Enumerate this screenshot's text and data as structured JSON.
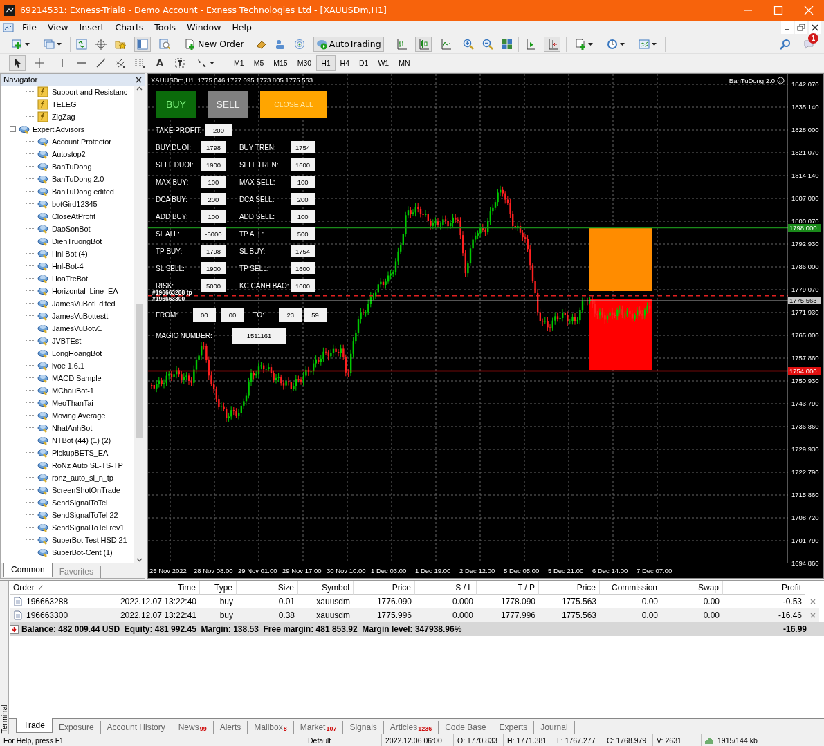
{
  "window": {
    "title": "69214531: Exness-Trial8 - Demo Account - Exness Technologies Ltd - [XAUUSDm,H1]"
  },
  "menu": [
    "File",
    "View",
    "Insert",
    "Charts",
    "Tools",
    "Window",
    "Help"
  ],
  "toolbar": {
    "new_order": "New Order",
    "auto_trading": "AutoTrading",
    "notification_count": "1"
  },
  "drawing_tools": {
    "text_tool": "A"
  },
  "timeframes": [
    {
      "label": "M1",
      "selected": false
    },
    {
      "label": "M5",
      "selected": false
    },
    {
      "label": "M15",
      "selected": false
    },
    {
      "label": "M30",
      "selected": false
    },
    {
      "label": "H1",
      "selected": true
    },
    {
      "label": "H4",
      "selected": false
    },
    {
      "label": "D1",
      "selected": false
    },
    {
      "label": "W1",
      "selected": false
    },
    {
      "label": "MN",
      "selected": false
    }
  ],
  "navigator": {
    "title": "Navigator",
    "indicators": [
      {
        "label": "Support and Resistanc"
      },
      {
        "label": "TELEG"
      },
      {
        "label": "ZigZag"
      }
    ],
    "expert_advisors": {
      "label": "Expert Advisors",
      "expanded": true,
      "children": [
        {
          "label": "Account Protector"
        },
        {
          "label": "Autostop2"
        },
        {
          "label": "BanTuDong"
        },
        {
          "label": "BanTuDong 2.0"
        },
        {
          "label": "BanTuDong edited"
        },
        {
          "label": "botGird12345"
        },
        {
          "label": "CloseAtProfit"
        },
        {
          "label": "DaoSonBot"
        },
        {
          "label": "DienTruongBot"
        },
        {
          "label": "Hnl Bot (4)"
        },
        {
          "label": "Hnl-Bot-4"
        },
        {
          "label": "HoaTreBot"
        },
        {
          "label": "Horizontal_Line_EA"
        },
        {
          "label": "JamesVuBotEdited"
        },
        {
          "label": "JamesVuBottestt"
        },
        {
          "label": "JamesVuBotv1"
        },
        {
          "label": "JVBTEst"
        },
        {
          "label": "LongHoangBot"
        },
        {
          "label": "lvoe 1.6.1"
        },
        {
          "label": "MACD Sample"
        },
        {
          "label": "MChauBot-1"
        },
        {
          "label": "MeoThanTai"
        },
        {
          "label": "Moving Average"
        },
        {
          "label": "NhatAnhBot"
        },
        {
          "label": "NTBot (44) (1) (2)"
        },
        {
          "label": "PickupBETS_EA"
        },
        {
          "label": "RoNz Auto SL-TS-TP"
        },
        {
          "label": "ronz_auto_sl_n_tp"
        },
        {
          "label": "ScreenShotOnTrade"
        },
        {
          "label": "SendSignalToTel"
        },
        {
          "label": "SendSignalToTel 22"
        },
        {
          "label": "SendSignalToTel rev1"
        },
        {
          "label": "SuperBot Test HSD 21-"
        },
        {
          "label": "SuperBot-Cent (1)"
        }
      ]
    },
    "tabs": [
      {
        "label": "Common",
        "selected": true
      },
      {
        "label": "Favorites",
        "selected": false
      }
    ]
  },
  "chart": {
    "header": "XAUUSDm,H1  1775.046 1777.095 1773.805 1775.563",
    "expert_name": "BanTuDong 2.0",
    "price_labels": [
      "1842.070",
      "1835.140",
      "1828.000",
      "1821.070",
      "1814.140",
      "1807.000",
      "1800.070",
      "1792.930",
      "1786.000",
      "1779.070",
      "1771.930",
      "1765.000",
      "1757.860",
      "1750.930",
      "1743.790",
      "1736.860",
      "1729.930",
      "1722.790",
      "1715.860",
      "1708.720",
      "1701.790",
      "1694.860"
    ],
    "price_tags": [
      {
        "text": "1798.000",
        "color": "#1a8a1a"
      },
      {
        "text": "1775.563",
        "color": "#c8c8c8"
      },
      {
        "text": "1754.000",
        "color": "#e01010"
      }
    ],
    "time_labels": [
      "25 Nov 2022",
      "28 Nov 08:00",
      "29 Nov 01:00",
      "29 Nov 17:00",
      "30 Nov 10:00",
      "1 Dec 03:00",
      "1 Dec 19:00",
      "2 Dec 12:00",
      "5 Dec 05:00",
      "5 Dec 21:00",
      "6 Dec 14:00",
      "7 Dec 07:00"
    ],
    "order_labels": [
      "#196663288 tp",
      "#196663300"
    ],
    "panel": {
      "buttons": [
        {
          "label": "BUY",
          "color": "#0b6b0b"
        },
        {
          "label": "SELL",
          "color": "#808080"
        },
        {
          "label": "CLOSE ALL",
          "color": "#ffa500"
        }
      ],
      "rows": [
        [
          {
            "label": "TAKE PROFIT:",
            "value": "200"
          }
        ],
        [
          {
            "label": "BUY DUOI:",
            "value": "1798"
          },
          {
            "label": "BUY TREN:",
            "value": "1754"
          }
        ],
        [
          {
            "label": "SELL DUOI:",
            "value": "1900"
          },
          {
            "label": "SELL TREN:",
            "value": "1600"
          }
        ],
        [
          {
            "label": "MAX BUY:",
            "value": "100"
          },
          {
            "label": "MAX SELL:",
            "value": "100"
          }
        ],
        [
          {
            "label": "DCA BUY:",
            "value": "200"
          },
          {
            "label": "DCA SELL:",
            "value": "200"
          }
        ],
        [
          {
            "label": "ADD BUY:",
            "value": "100"
          },
          {
            "label": "ADD SELL:",
            "value": "100"
          }
        ],
        [
          {
            "label": "SL ALL:",
            "value": "-5000"
          },
          {
            "label": "TP ALL:",
            "value": "500"
          }
        ],
        [
          {
            "label": "TP BUY:",
            "value": "1798"
          },
          {
            "label": "SL BUY:",
            "value": "1754"
          }
        ],
        [
          {
            "label": "SL SELL:",
            "value": "1900"
          },
          {
            "label": "TP SELL:",
            "value": "1600"
          }
        ],
        [
          {
            "label": "RISK:",
            "value": "5000"
          },
          {
            "label": "KC CANH BAO:",
            "value": "1000"
          }
        ]
      ],
      "time_filter": {
        "from_label": "FROM:",
        "from": [
          "00",
          "00"
        ],
        "to_label": "TO:",
        "to": [
          "23",
          "59"
        ]
      },
      "magic": {
        "label": "MAGIC NUMBER:",
        "value": "1511161"
      }
    }
  },
  "terminal": {
    "title": "Terminal",
    "columns": [
      "Order",
      "Time",
      "Type",
      "Size",
      "Symbol",
      "Price",
      "S / L",
      "T / P",
      "Price",
      "Commission",
      "Swap",
      "Profit"
    ],
    "rows": [
      [
        "196663288",
        "2022.12.07 13:22:40",
        "buy",
        "0.01",
        "xauusdm",
        "1776.090",
        "0.000",
        "1778.090",
        "1775.563",
        "0.00",
        "0.00",
        "-0.53"
      ],
      [
        "196663300",
        "2022.12.07 13:22:41",
        "buy",
        "0.38",
        "xauusdm",
        "1775.996",
        "0.000",
        "1777.996",
        "1775.563",
        "0.00",
        "0.00",
        "-16.46"
      ]
    ],
    "summary": {
      "text": "Balance: 482 009.44 USD  Equity: 481 992.45  Margin: 138.53  Free margin: 481 853.92  Margin level: 347938.96%",
      "profit": "-16.99"
    },
    "tabs": [
      {
        "label": "Trade",
        "selected": true
      },
      {
        "label": "Exposure",
        "selected": false
      },
      {
        "label": "Account History",
        "selected": false
      },
      {
        "label": "News",
        "badge": "99",
        "selected": false
      },
      {
        "label": "Alerts",
        "selected": false
      },
      {
        "label": "Mailbox",
        "badge": "8",
        "selected": false
      },
      {
        "label": "Market",
        "badge": "107",
        "selected": false
      },
      {
        "label": "Signals",
        "selected": false
      },
      {
        "label": "Articles",
        "badge": "1236",
        "selected": false
      },
      {
        "label": "Code Base",
        "selected": false
      },
      {
        "label": "Experts",
        "selected": false
      },
      {
        "label": "Journal",
        "selected": false
      }
    ]
  },
  "status_bar": {
    "help": "For Help, press F1",
    "profile": "Default",
    "time": "2022.12.06 06:00",
    "open": "O: 1770.833",
    "high": "H: 1771.381",
    "low": "L: 1767.277",
    "close": "C: 1768.979",
    "volume": "V: 2631",
    "traffic": "1915/144 kb"
  }
}
